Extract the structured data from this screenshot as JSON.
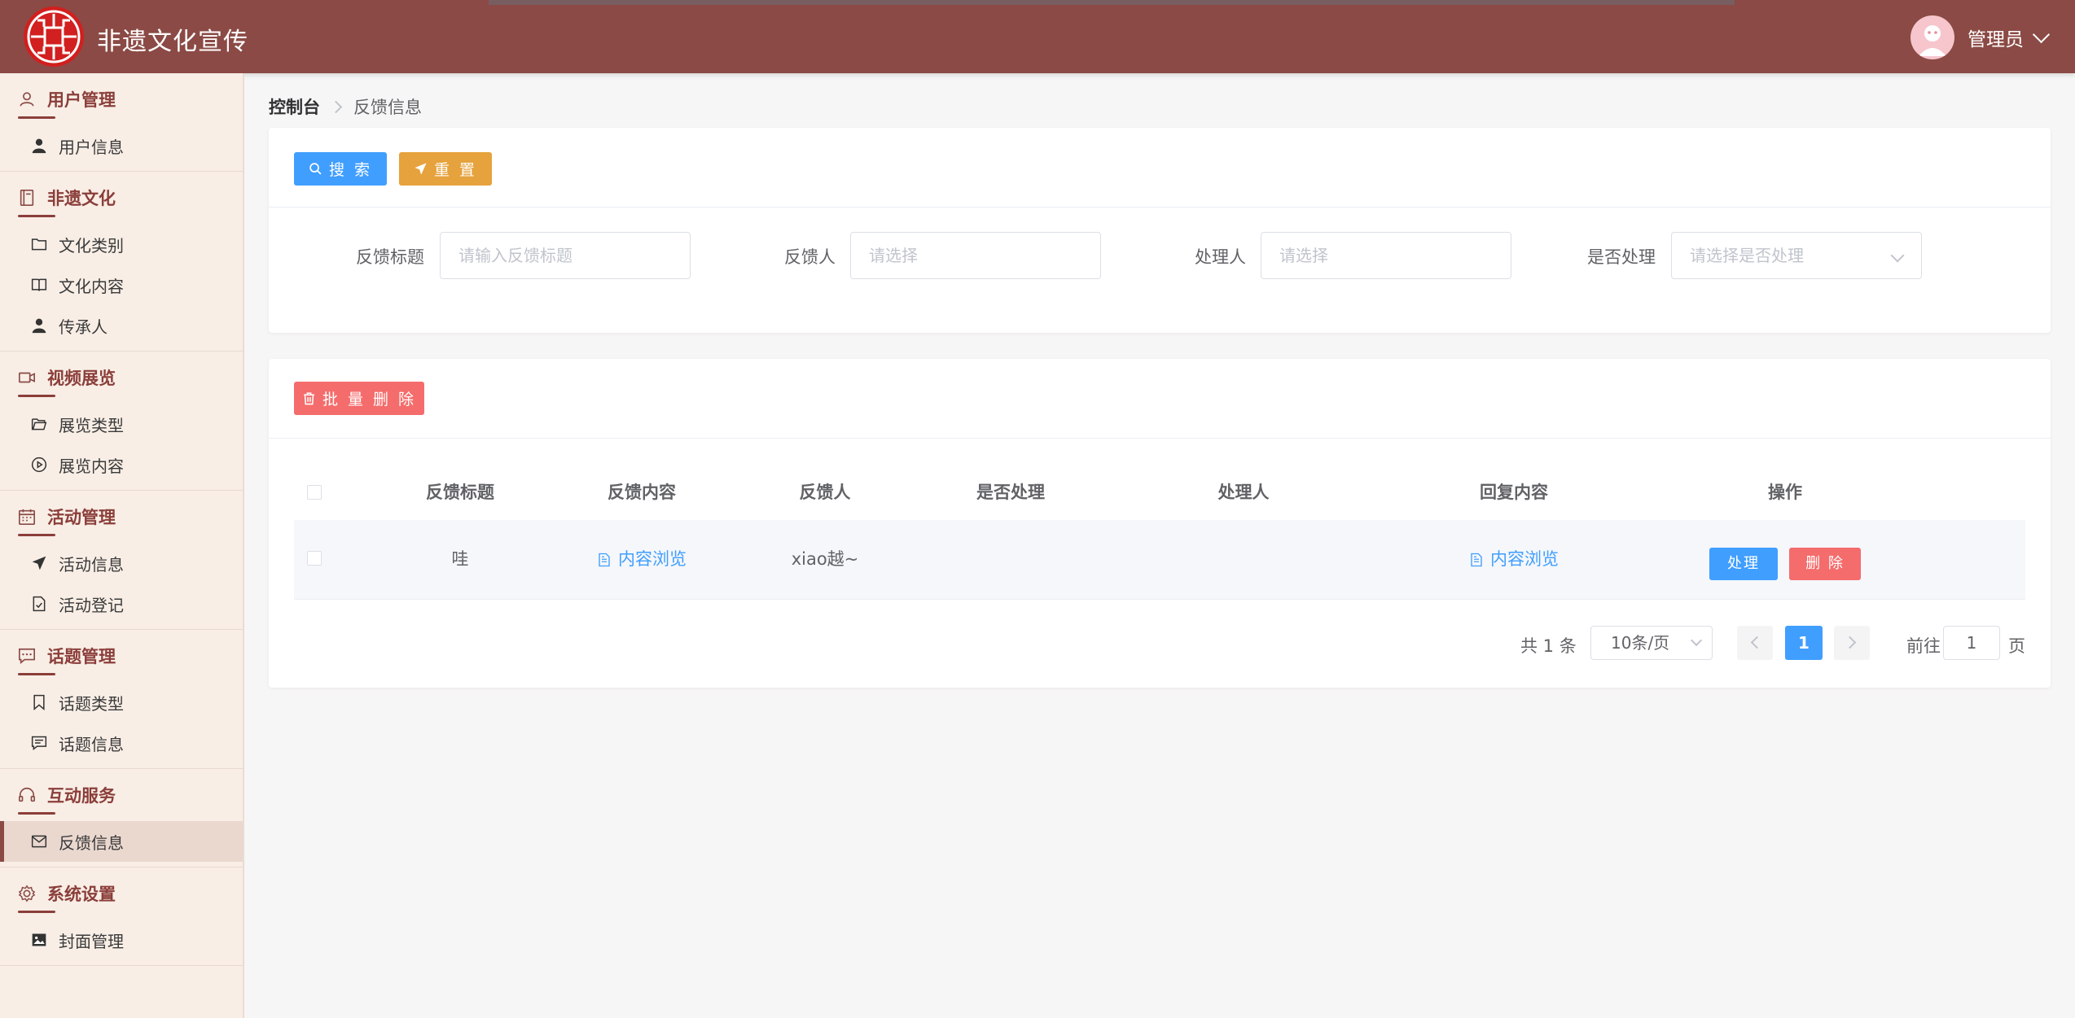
{
  "app": {
    "title": "非遗文化宣传",
    "user": "管理员"
  },
  "colors": {
    "primary": "#8b4a45",
    "blue": "#409eff",
    "orange": "#e6a23c",
    "red": "#f56c6c"
  },
  "sidebar": {
    "groups": [
      {
        "title": "用户管理",
        "icon": "user-outline-icon",
        "items": [
          {
            "label": "用户信息",
            "icon": "user-filled-icon"
          }
        ]
      },
      {
        "title": "非遗文化",
        "icon": "notebook-icon",
        "items": [
          {
            "label": "文化类别",
            "icon": "folder-icon"
          },
          {
            "label": "文化内容",
            "icon": "book-icon"
          },
          {
            "label": "传承人",
            "icon": "person-icon"
          }
        ]
      },
      {
        "title": "视频展览",
        "icon": "video-camera-icon",
        "items": [
          {
            "label": "展览类型",
            "icon": "folder-opened-icon"
          },
          {
            "label": "展览内容",
            "icon": "play-circle-icon"
          }
        ]
      },
      {
        "title": "活动管理",
        "icon": "calendar-icon",
        "items": [
          {
            "label": "活动信息",
            "icon": "send-icon"
          },
          {
            "label": "活动登记",
            "icon": "document-check-icon"
          }
        ]
      },
      {
        "title": "话题管理",
        "icon": "chat-dots-icon",
        "items": [
          {
            "label": "话题类型",
            "icon": "bookmark-icon"
          },
          {
            "label": "话题信息",
            "icon": "chat-lines-icon"
          }
        ]
      },
      {
        "title": "互动服务",
        "icon": "headset-icon",
        "items": [
          {
            "label": "反馈信息",
            "icon": "message-icon",
            "active": true
          }
        ]
      },
      {
        "title": "系统设置",
        "icon": "setting-icon",
        "items": [
          {
            "label": "封面管理",
            "icon": "picture-icon"
          }
        ]
      }
    ]
  },
  "breadcrumb": {
    "home": "控制台",
    "current": "反馈信息"
  },
  "search": {
    "search_label": "搜 索",
    "reset_label": "重 置",
    "fields": [
      {
        "label": "反馈标题",
        "placeholder": "请输入反馈标题"
      },
      {
        "label": "反馈人",
        "placeholder": "请选择"
      },
      {
        "label": "处理人",
        "placeholder": "请选择"
      },
      {
        "label": "是否处理",
        "placeholder": "请选择是否处理"
      }
    ]
  },
  "table": {
    "batch_delete_label": "批 量 删 除",
    "columns": [
      "反馈标题",
      "反馈内容",
      "反馈人",
      "是否处理",
      "处理人",
      "回复内容",
      "操作"
    ],
    "rows": [
      {
        "title": "哇",
        "content": "内容浏览",
        "user": "xiao越~",
        "handled": "",
        "handler": "",
        "reply": "内容浏览",
        "handle_label": "处理",
        "delete_label": "删 除"
      }
    ]
  },
  "pager": {
    "total": "共 1 条",
    "page_size": "10条/页",
    "current": "1",
    "goto_prefix": "前往",
    "goto_value": "1",
    "goto_suffix": "页"
  }
}
